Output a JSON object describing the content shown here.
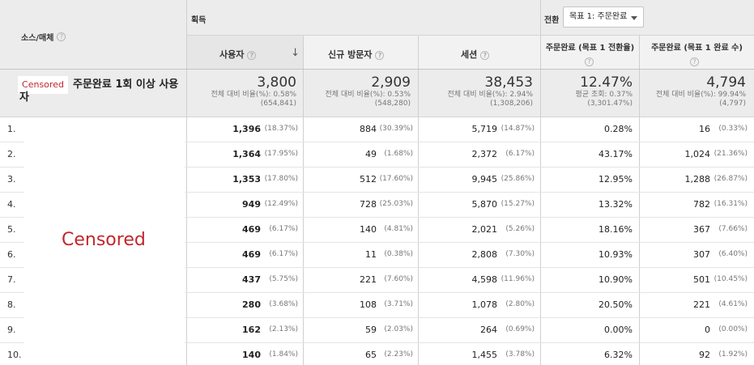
{
  "header": {
    "source_medium": "소스/매체",
    "acquisition": "획득",
    "conversion": "전환",
    "goal_select": "목표 1: 주문완료",
    "columns": {
      "users": "사용자",
      "new_visitors": "신규 방문자",
      "sessions": "세션",
      "conv_rate": "주문완료 (목표 1 전환율)",
      "completions": "주문완료 (목표 1 완료 수)"
    },
    "help_glyph": "?"
  },
  "segment": {
    "censored_label": "Censored",
    "name": "주문완료 1회 이상 사용자"
  },
  "totals": {
    "users": {
      "value": "3,800",
      "sub1": "전체 대비 비율(%): 0.58%",
      "sub2": "(654,841)"
    },
    "new_visitors": {
      "value": "2,909",
      "sub1": "전체 대비 비율(%): 0.53%",
      "sub2": "(548,280)"
    },
    "sessions": {
      "value": "38,453",
      "sub1": "전체 대비 비율(%): 2.94%",
      "sub2": "(1,308,206)"
    },
    "conv_rate": {
      "value": "12.47%",
      "sub1": "평균 조회: 0.37%",
      "sub2": "(3,301.47%)"
    },
    "completions": {
      "value": "4,794",
      "sub1": "전체 대비 비율(%): 99.94%",
      "sub2": "(4,797)"
    }
  },
  "censored_rows_label": "Censored",
  "rows": [
    {
      "num": "1.",
      "users": "1,396",
      "users_pct": "(18.37%)",
      "new": "884",
      "new_pct": "(30.39%)",
      "sessions": "5,719",
      "sessions_pct": "(14.87%)",
      "rate": "0.28%",
      "comp": "16",
      "comp_pct": "(0.33%)"
    },
    {
      "num": "2.",
      "users": "1,364",
      "users_pct": "(17.95%)",
      "new": "49",
      "new_pct": "(1.68%)",
      "sessions": "2,372",
      "sessions_pct": "(6.17%)",
      "rate": "43.17%",
      "comp": "1,024",
      "comp_pct": "(21.36%)"
    },
    {
      "num": "3.",
      "users": "1,353",
      "users_pct": "(17.80%)",
      "new": "512",
      "new_pct": "(17.60%)",
      "sessions": "9,945",
      "sessions_pct": "(25.86%)",
      "rate": "12.95%",
      "comp": "1,288",
      "comp_pct": "(26.87%)"
    },
    {
      "num": "4.",
      "users": "949",
      "users_pct": "(12.49%)",
      "new": "728",
      "new_pct": "(25.03%)",
      "sessions": "5,870",
      "sessions_pct": "(15.27%)",
      "rate": "13.32%",
      "comp": "782",
      "comp_pct": "(16.31%)"
    },
    {
      "num": "5.",
      "users": "469",
      "users_pct": "(6.17%)",
      "new": "140",
      "new_pct": "(4.81%)",
      "sessions": "2,021",
      "sessions_pct": "(5.26%)",
      "rate": "18.16%",
      "comp": "367",
      "comp_pct": "(7.66%)"
    },
    {
      "num": "6.",
      "users": "469",
      "users_pct": "(6.17%)",
      "new": "11",
      "new_pct": "(0.38%)",
      "sessions": "2,808",
      "sessions_pct": "(7.30%)",
      "rate": "10.93%",
      "comp": "307",
      "comp_pct": "(6.40%)"
    },
    {
      "num": "7.",
      "users": "437",
      "users_pct": "(5.75%)",
      "new": "221",
      "new_pct": "(7.60%)",
      "sessions": "4,598",
      "sessions_pct": "(11.96%)",
      "rate": "10.90%",
      "comp": "501",
      "comp_pct": "(10.45%)"
    },
    {
      "num": "8.",
      "users": "280",
      "users_pct": "(3.68%)",
      "new": "108",
      "new_pct": "(3.71%)",
      "sessions": "1,078",
      "sessions_pct": "(2.80%)",
      "rate": "20.50%",
      "comp": "221",
      "comp_pct": "(4.61%)"
    },
    {
      "num": "9.",
      "users": "162",
      "users_pct": "(2.13%)",
      "new": "59",
      "new_pct": "(2.03%)",
      "sessions": "264",
      "sessions_pct": "(0.69%)",
      "rate": "0.00%",
      "comp": "0",
      "comp_pct": "(0.00%)"
    },
    {
      "num": "10.",
      "users": "140",
      "users_pct": "(1.84%)",
      "new": "65",
      "new_pct": "(2.23%)",
      "sessions": "1,455",
      "sessions_pct": "(3.78%)",
      "rate": "6.32%",
      "comp": "92",
      "comp_pct": "(1.92%)"
    }
  ]
}
